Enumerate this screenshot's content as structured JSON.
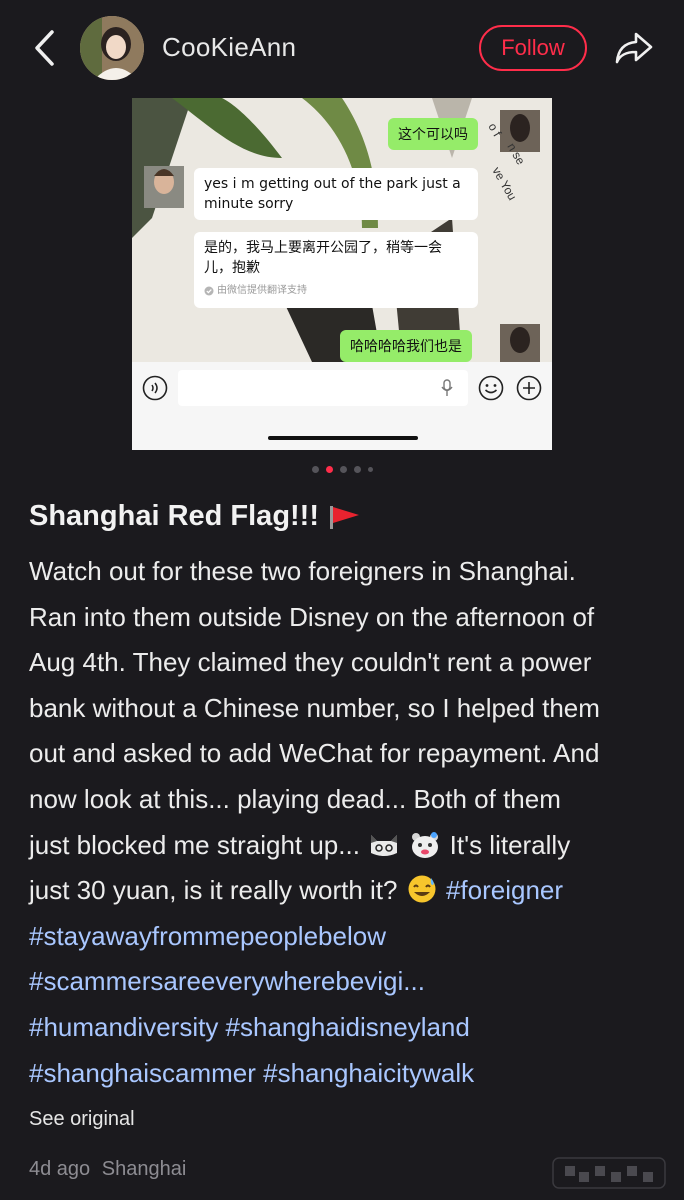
{
  "header": {
    "username": "CooKieAnn",
    "follow_label": "Follow",
    "icons": {
      "back": "chevron-left-icon",
      "share": "share-arrow-icon"
    }
  },
  "screenshot": {
    "messages": [
      {
        "side": "right",
        "text": "这个可以吗"
      },
      {
        "side": "left",
        "text": "yes i m getting out of the park just a minute sorry"
      },
      {
        "side": "left",
        "text": "是的，我马上要离开公园了，稍等一会儿，抱歉",
        "note": "由微信提供翻译支持"
      },
      {
        "side": "right",
        "text": "哈哈哈哈我们也是"
      }
    ],
    "colors": {
      "sent_bubble": "#95ec69",
      "received_bubble": "#ffffff"
    }
  },
  "carousel": {
    "total": 5,
    "active": 2
  },
  "post": {
    "title": "Shanghai Red Flag!!!",
    "body_lines": [
      "Watch out for these two foreigners in Shanghai.",
      "Ran into them outside Disney on the afternoon of",
      "Aug 4th. They claimed they couldn't rent a power",
      "bank without a Chinese number, so I helped them",
      "out and asked to add WeChat for repayment. And",
      "now look at this... playing dead... Both of them"
    ],
    "line7_text": "just blocked me straight up...",
    "line7_tail": "It's literally",
    "line8_text": "just 30 yuan, is it really worth it?",
    "hashtags": [
      "#foreigner",
      "#stayawayfrommepeoplebelow",
      "#scammersareeverywherebevigi...",
      "#humandiversity",
      "#shanghaidisneyland",
      "#shanghaiscammer",
      "#shanghaicitywalk"
    ],
    "see_original": "See original",
    "time_ago": "4d ago",
    "location": "Shanghai"
  },
  "accent_color": "#ff2d4a",
  "hashtag_color": "#a9c7ff"
}
